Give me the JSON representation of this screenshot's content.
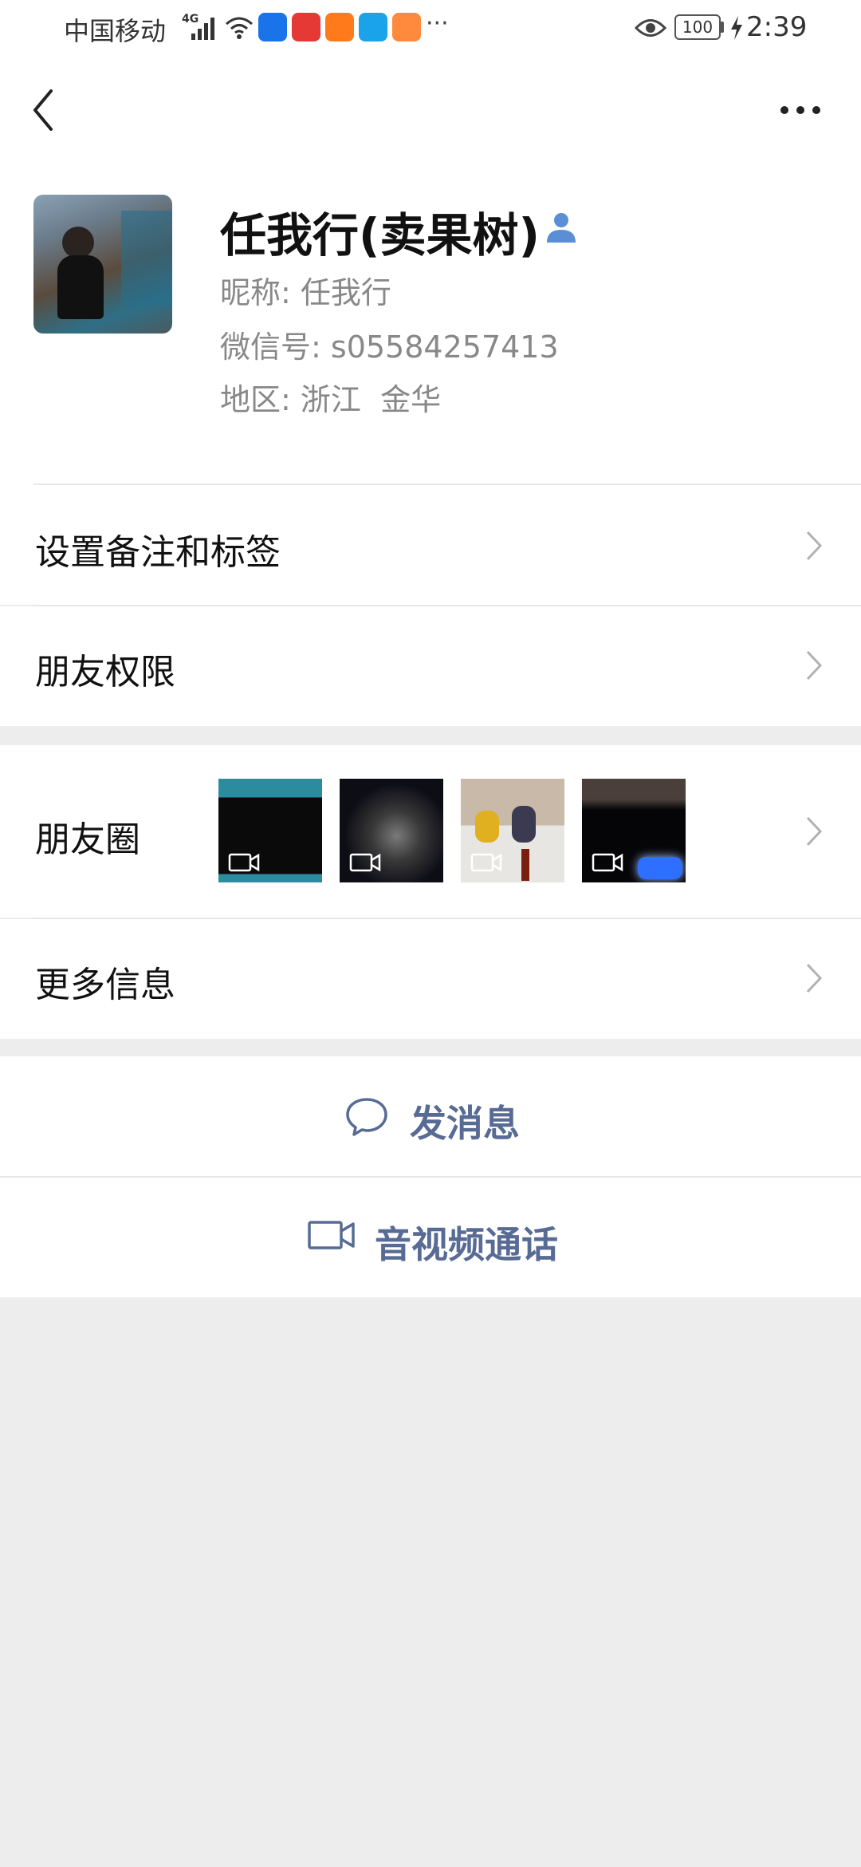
{
  "status_bar": {
    "carrier": "中国移动",
    "network": "4G",
    "battery": "100",
    "time": "2:39"
  },
  "profile": {
    "display_name": "任我行(卖果树)",
    "nickname_label": "昵称:",
    "nickname": "任我行",
    "wechat_id_label": "微信号:",
    "wechat_id": "s05584257413",
    "region_label": "地区:",
    "region": "浙江  金华"
  },
  "menu": {
    "set_remark_tags": "设置备注和标签",
    "friend_permissions": "朋友权限",
    "moments": "朋友圈",
    "more_info": "更多信息"
  },
  "actions": {
    "send_message": "发消息",
    "video_call": "音视频通话"
  },
  "colors": {
    "accent": "#576b95",
    "background": "#ededed",
    "verified_icon": "#5a8fd6"
  }
}
